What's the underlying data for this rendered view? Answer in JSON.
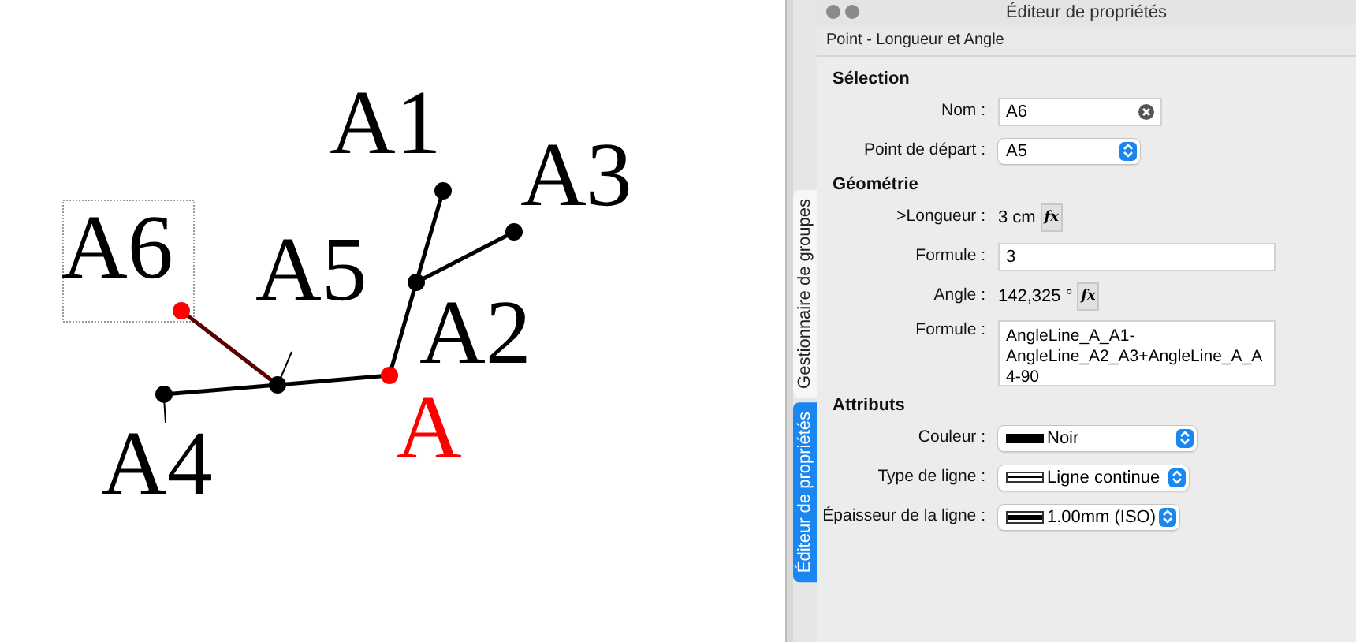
{
  "canvas": {
    "labels": [
      {
        "text": "A1",
        "color": "#000000",
        "selected": false
      },
      {
        "text": "A3",
        "color": "#000000",
        "selected": false
      },
      {
        "text": "A6",
        "color": "#000000",
        "selected": true
      },
      {
        "text": "A5",
        "color": "#000000",
        "selected": false
      },
      {
        "text": "A2",
        "color": "#000000",
        "selected": false
      },
      {
        "text": "A",
        "color": "#ff0000",
        "selected": false
      },
      {
        "text": "A4",
        "color": "#000000",
        "selected": false
      }
    ],
    "points": [
      {
        "color": "#ff0000"
      },
      {
        "color": "#000000"
      },
      {
        "color": "#000000"
      },
      {
        "color": "#ff0000"
      },
      {
        "color": "#000000"
      },
      {
        "color": "#000000"
      },
      {
        "color": "#000000"
      }
    ]
  },
  "side_tabs": [
    {
      "label": "Gestionnaire de groupes",
      "selected": false
    },
    {
      "label": "Éditeur de propriétés",
      "selected": true
    }
  ],
  "panel": {
    "title": "Éditeur de propriétés",
    "subtitle": "Point - Longueur et Angle",
    "sections": [
      {
        "title": "Sélection",
        "rows": [
          {
            "kind": "input",
            "label": "Nom :",
            "value": "A6"
          },
          {
            "kind": "select",
            "label": "Point de départ :",
            "value": "A5"
          }
        ]
      },
      {
        "title": "Géométrie",
        "rows": [
          {
            "kind": "reading",
            "label": ">Longueur :",
            "value": "3 cm",
            "button": "fx"
          },
          {
            "kind": "input",
            "label": "Formule :",
            "value": "3"
          },
          {
            "kind": "reading",
            "label": "Angle :",
            "value": "142,325 °",
            "button": "fx"
          },
          {
            "kind": "textarea",
            "label": "Formule :",
            "value": "AngleLine_A_A1-AngleLine_A2_A3+AngleLine_A_A4-90"
          }
        ]
      },
      {
        "title": "Attributs",
        "rows": [
          {
            "kind": "color",
            "label": "Couleur :",
            "value": "Noir"
          },
          {
            "kind": "linestyle",
            "label": "Type de ligne :",
            "value": "Ligne continue"
          },
          {
            "kind": "thickness",
            "label": "Épaisseur de la ligne :",
            "value": "1.00mm (ISO)"
          }
        ]
      }
    ]
  }
}
